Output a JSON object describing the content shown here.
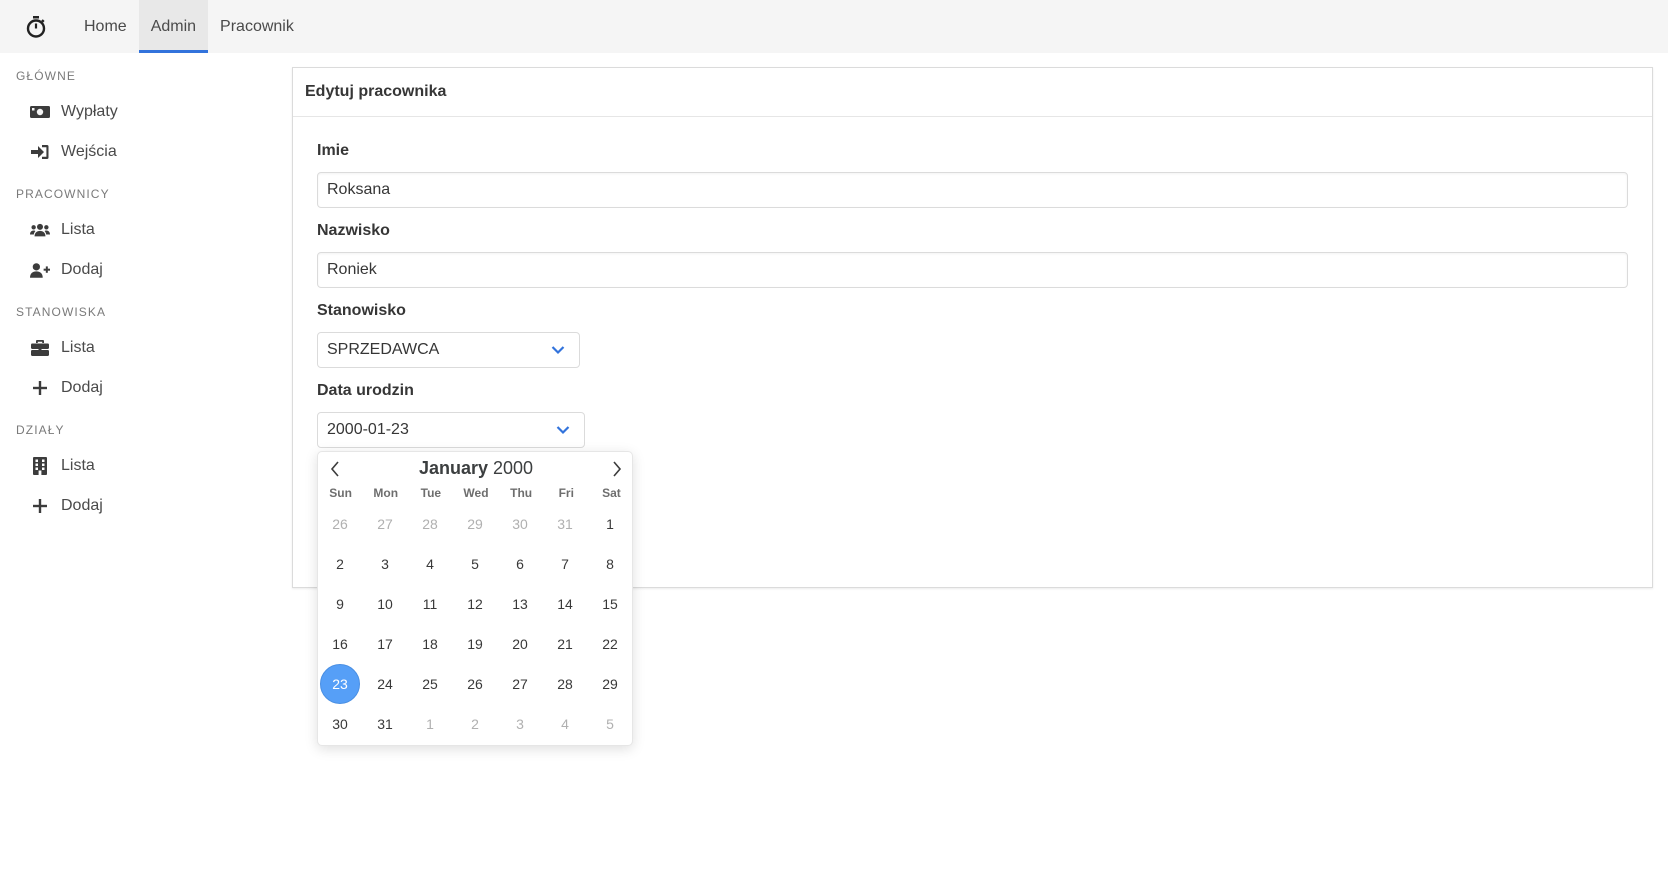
{
  "navbar": {
    "brand_icon": "stopwatch-icon",
    "items": [
      {
        "label": "Home",
        "active": false
      },
      {
        "label": "Admin",
        "active": true
      },
      {
        "label": "Pracownik",
        "active": false
      }
    ]
  },
  "sidebar": {
    "sections": [
      {
        "label": "GŁÓWNE",
        "items": [
          {
            "label": "Wypłaty",
            "icon": "money-icon"
          },
          {
            "label": "Wejścia",
            "icon": "sign-in-icon"
          }
        ]
      },
      {
        "label": "PRACOWNICY",
        "items": [
          {
            "label": "Lista",
            "icon": "users-icon"
          },
          {
            "label": "Dodaj",
            "icon": "user-plus-icon"
          }
        ]
      },
      {
        "label": "STANOWISKA",
        "items": [
          {
            "label": "Lista",
            "icon": "briefcase-icon"
          },
          {
            "label": "Dodaj",
            "icon": "plus-icon"
          }
        ]
      },
      {
        "label": "DZIAŁY",
        "items": [
          {
            "label": "Lista",
            "icon": "building-icon"
          },
          {
            "label": "Dodaj",
            "icon": "plus-icon"
          }
        ]
      }
    ]
  },
  "card": {
    "title": "Edytuj pracownika",
    "fields": {
      "first_name": {
        "label": "Imie",
        "value": "Roksana"
      },
      "last_name": {
        "label": "Nazwisko",
        "value": "Roniek"
      },
      "position": {
        "label": "Stanowisko",
        "value": "SPRZEDAWCA"
      },
      "birth_date": {
        "label": "Data urodzin",
        "value": "2000-01-23"
      }
    }
  },
  "calendar": {
    "month": "January",
    "year": "2000",
    "weekdays": [
      "Sun",
      "Mon",
      "Tue",
      "Wed",
      "Thu",
      "Fri",
      "Sat"
    ],
    "weeks": [
      [
        "26",
        "27",
        "28",
        "29",
        "30",
        "31",
        "1"
      ],
      [
        "2",
        "3",
        "4",
        "5",
        "6",
        "7",
        "8"
      ],
      [
        "9",
        "10",
        "11",
        "12",
        "13",
        "14",
        "15"
      ],
      [
        "16",
        "17",
        "18",
        "19",
        "20",
        "21",
        "22"
      ],
      [
        "23",
        "24",
        "25",
        "26",
        "27",
        "28",
        "29"
      ],
      [
        "30",
        "31",
        "1",
        "2",
        "3",
        "4",
        "5"
      ]
    ],
    "selected_day": "23",
    "accent_color": "#569ff7"
  }
}
